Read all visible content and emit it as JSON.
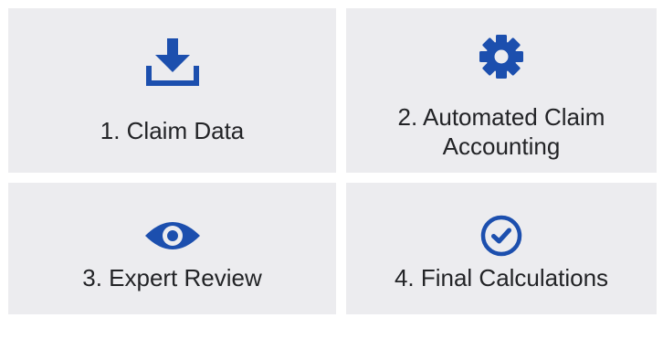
{
  "colors": {
    "tile_background": "#ececef",
    "icon": "#1c4fae",
    "text": "#222326"
  },
  "steps": [
    {
      "label": "1. Claim Data",
      "icon": "download-icon"
    },
    {
      "label": "2. Automated Claim\nAccounting",
      "icon": "gear-icon"
    },
    {
      "label": "3. Expert Review",
      "icon": "eye-icon"
    },
    {
      "label": "4. Final Calculations",
      "icon": "check-circle-icon"
    }
  ]
}
